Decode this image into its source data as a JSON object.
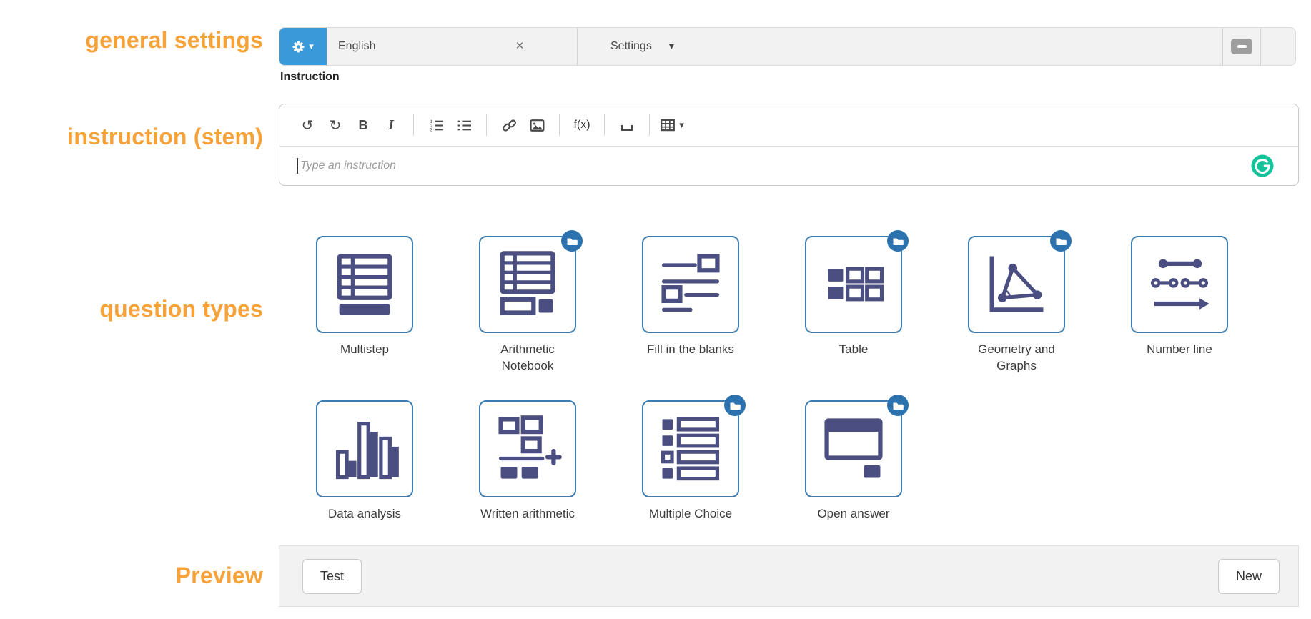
{
  "annotations": {
    "general_settings": "general settings",
    "instruction_stem": "instruction (stem)",
    "question_types": "question types",
    "preview": "Preview"
  },
  "general_settings_bar": {
    "gear_caret": "▾",
    "language_tab": {
      "label": "English",
      "close": "×"
    },
    "settings": {
      "label": "Settings",
      "caret": "▾"
    }
  },
  "instruction": {
    "heading": "Instruction",
    "editor": {
      "placeholder": "Type an instruction",
      "toolbar": {
        "undo": "↺",
        "redo": "↻",
        "bold": "B",
        "italic": "I",
        "formula": "f(x)",
        "table_caret": "▾"
      }
    }
  },
  "question_types": {
    "tiles": [
      {
        "label": "Multistep",
        "badge": false
      },
      {
        "label": "Arithmetic Notebook",
        "badge": true
      },
      {
        "label": "Fill in the blanks",
        "badge": false
      },
      {
        "label": "Table",
        "badge": true
      },
      {
        "label": "Geometry and Graphs",
        "badge": true
      },
      {
        "label": "Number line",
        "badge": false
      },
      {
        "label": "Data analysis",
        "badge": false
      },
      {
        "label": "Written arithmetic",
        "badge": false
      },
      {
        "label": "Multiple Choice",
        "badge": true
      },
      {
        "label": "Open answer",
        "badge": true
      }
    ]
  },
  "preview": {
    "test_button": "Test",
    "new_button": "New"
  },
  "colors": {
    "annotation_orange": "#F7A239",
    "gear_button_blue": "#3A9AD9",
    "tile_border_blue": "#3d7cb1",
    "tile_glyph_indigo": "#4b4e80",
    "badge_blue": "#2b72ae",
    "grammarly_green": "#15c39a",
    "bar_background": "#f2f2f2"
  }
}
